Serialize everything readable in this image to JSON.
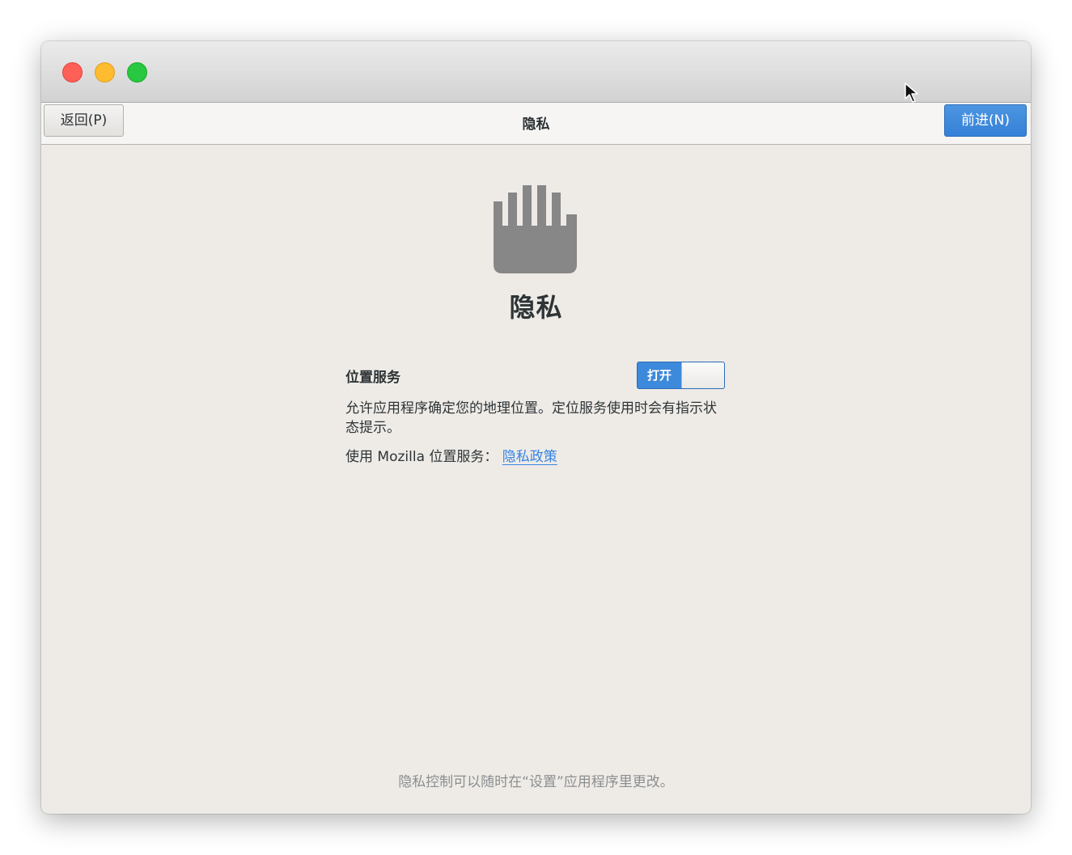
{
  "window": {
    "controls": {
      "close": "close-control",
      "minimize": "minimize-control",
      "maximize": "maximize-control"
    }
  },
  "header": {
    "back_label": "返回(P)",
    "title": "隐私",
    "next_label": "前进(N)"
  },
  "page": {
    "icon": "hand-icon",
    "title": "隐私",
    "location_services": {
      "label": "位置服务",
      "toggle_state_label": "打开",
      "enabled": true,
      "description": "允许应用程序确定您的地理位置。定位服务使用时会有指示状态提示。",
      "provider_text": "使用 Mozilla 位置服务：",
      "policy_link": "隐私政策"
    },
    "footer_note": "隐私控制可以随时在“设置”应用程序里更改。"
  },
  "colors": {
    "accent": "#3584e4",
    "window_bg": "#eeebe7",
    "text": "#2e3436",
    "muted_text": "#8b8e8f",
    "icon": "#868786"
  }
}
